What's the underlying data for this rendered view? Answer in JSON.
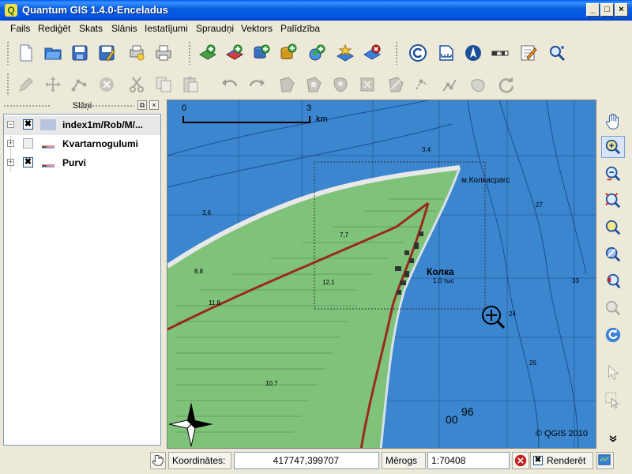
{
  "window": {
    "title": "Quantum GIS 1.4.0-Enceladus",
    "app_icon": "qgis-logo-icon",
    "min_label": "_",
    "max_label": "□",
    "close_label": "×"
  },
  "menu": [
    "Fails",
    "Rediģēt",
    "Skats",
    "Slānis",
    "Iestatījumi",
    "Spraudņi",
    "Vektors",
    "Palīdzība"
  ],
  "toolbar_main": [
    "new-project-icon",
    "open-project-icon",
    "save-project-icon",
    "save-as-icon",
    "print-composer-icon",
    "print-icon",
    "add-raster-layer-icon",
    "add-raster-gdal-icon",
    "add-postgis-layer-icon",
    "add-spatialite-layer-icon",
    "add-wms-layer-icon",
    "new-vector-layer-icon",
    "remove-layer-icon",
    "copyright-label-icon",
    "scale-bar-icon",
    "north-arrow-icon",
    "measure-line-icon",
    "edit-note-icon",
    "search-zoom-icon"
  ],
  "toolbar_edit": [
    "pencil-icon",
    "move-feature-icon",
    "node-tool-icon",
    "delete-icon",
    "cut-icon",
    "copy-icon",
    "paste-icon",
    "undo-icon",
    "redo-icon",
    "add-ring-icon",
    "add-island-icon",
    "delete-ring-icon",
    "delete-part-icon",
    "reshape-icon",
    "split-icon",
    "merge-icon",
    "node-split-icon",
    "rotate-icon",
    "refresh-icon"
  ],
  "legend_panel": {
    "title": "Slāņi",
    "float_label": "⧉",
    "close_label": "×",
    "layers": [
      {
        "name": "index1m/Rob/M/...",
        "checked": true,
        "check_mark": "✖"
      },
      {
        "name": "Kvartarnogulumi",
        "checked": false,
        "check_mark": ""
      },
      {
        "name": "Purvi",
        "checked": true,
        "check_mark": "✖"
      }
    ]
  },
  "map": {
    "scale_start": "0",
    "scale_end": "3",
    "scale_unit": "km",
    "copyright": "© QGIS 2010",
    "water_color": "#3b86cf",
    "land_color": "#7fc27a",
    "town_label": "Колка",
    "town_sub": "1,0 тыс",
    "village_label": "м.Колкасрагс",
    "depth_labels": [
      "3,4",
      "3,6",
      "27",
      "33",
      "24",
      "26",
      "96",
      "00"
    ],
    "map_numbers": [
      "7,7",
      "12,1",
      "8,8",
      "11,8",
      "10,7"
    ]
  },
  "map_tools": [
    "pan-hand-icon",
    "zoom-in-icon",
    "zoom-out-icon",
    "zoom-full-icon",
    "zoom-layer-icon",
    "zoom-selection-icon",
    "zoom-last-icon",
    "zoom-next-icon",
    "refresh-map-icon",
    "identify-icon",
    "select-features-icon",
    "more-tools-icon"
  ],
  "status": {
    "coord_label": "Koordinātes:",
    "coord_value": "417747,399707",
    "scale_label": "Mērogs",
    "scale_value": "1:70408",
    "render_label": "Renderēt",
    "render_checked": true
  }
}
